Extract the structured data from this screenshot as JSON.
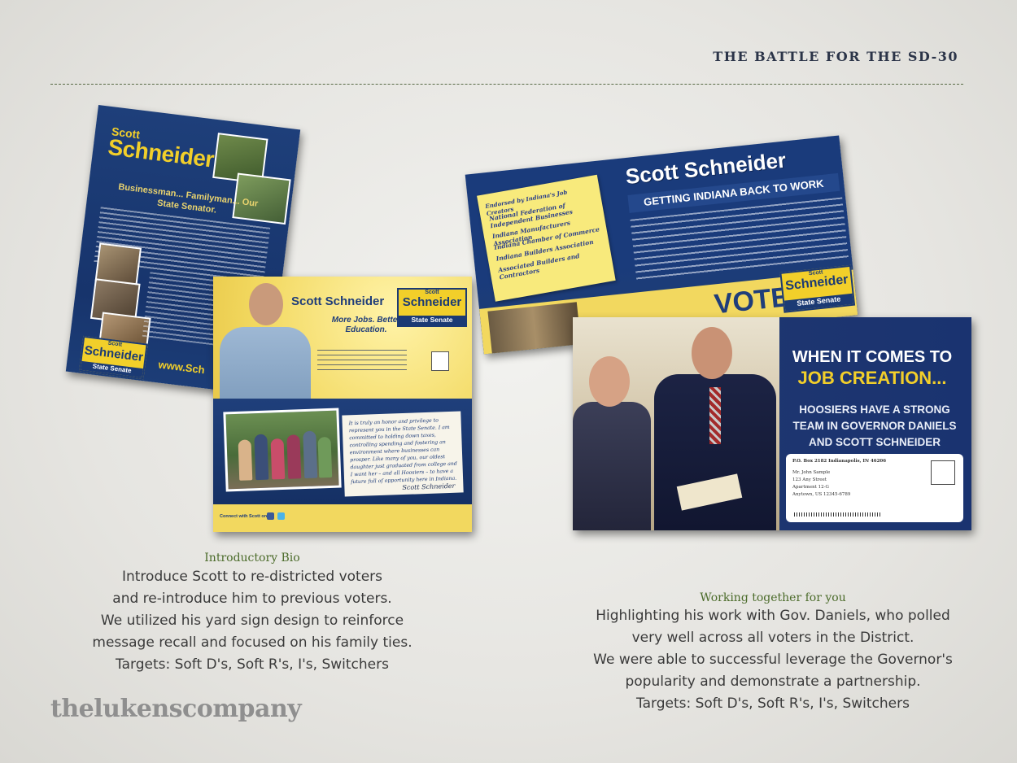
{
  "header": {
    "title": "THE BATTLE FOR THE SD-30"
  },
  "left_piece": {
    "back": {
      "first_name": "Scott",
      "last_name": "Schneider",
      "tagline": "Businessman... Familyman... Our State Senator.",
      "logo_first": "Scott",
      "logo_last": "Schneider",
      "logo_office": "State Senate",
      "website": "www.Sch"
    },
    "front": {
      "name": "Scott Schneider",
      "tagline": "More Jobs. Better Education.",
      "logo_first": "Scott",
      "logo_last": "Schneider",
      "logo_office": "State Senate",
      "note": "It is truly an honor and privilege to represent you in the State Senate. I am committed to holding down taxes, controlling spending and fostering an environment where businesses can prosper. Like many of you, our oldest daughter just graduated from college and I want her – and all Hoosiers – to have a future full of opportunity here in Indiana.",
      "signature": "Scott Schneider",
      "connect": "Connect with Scott on:"
    }
  },
  "right_piece": {
    "back": {
      "name": "Scott Schneider",
      "subtitle": "GETTING INDIANA BACK TO WORK",
      "endorsed_heading": "Endorsed by Indiana's Job Creators",
      "endorsements": [
        "National Federation of Independent Businesses",
        "Indiana Manufacturers Association",
        "Indiana Chamber of Commerce",
        "Indiana Builders Association",
        "Associated Builders and Contractors"
      ],
      "vote": "VOTE",
      "logo_first": "Scott",
      "logo_last": "Schneider",
      "logo_office": "State Senate"
    },
    "front": {
      "headline_line1": "WHEN IT COMES TO",
      "headline_line2": "JOB CREATION...",
      "subhead": "HOOSIERS HAVE A STRONG TEAM IN GOVERNOR DANIELS AND SCOTT SCHNEIDER",
      "return_address": "P.O. Box 2182  Indianapolis, IN 46206",
      "address_lines": [
        "Mr. John Sample",
        "123 Any Street",
        "Apartment 12-G",
        "Anytown, US 12345-6789"
      ]
    }
  },
  "captions": {
    "left": {
      "heading": "Introductory Bio",
      "lines": [
        "Introduce Scott to re-districted voters",
        "and  re-introduce him to previous voters.",
        "We utilized his yard sign design to reinforce",
        "message recall and focused on his family ties.",
        "Targets: Soft D's, Soft R's, I's, Switchers"
      ]
    },
    "right": {
      "heading": "Working together for you",
      "lines": [
        "Highlighting his work with Gov. Daniels, who polled",
        "very well across all voters in the District.",
        "We were able to successful leverage the Governor's",
        "popularity and demonstrate a partnership.",
        "Targets: Soft D's, Soft R's, I's, Switchers"
      ]
    }
  },
  "footer": {
    "company_logo": "thelukenscompany"
  },
  "colors": {
    "navy": "#1b3a74",
    "gold": "#f2cf2a",
    "caption_heading": "#4b6b2a"
  }
}
